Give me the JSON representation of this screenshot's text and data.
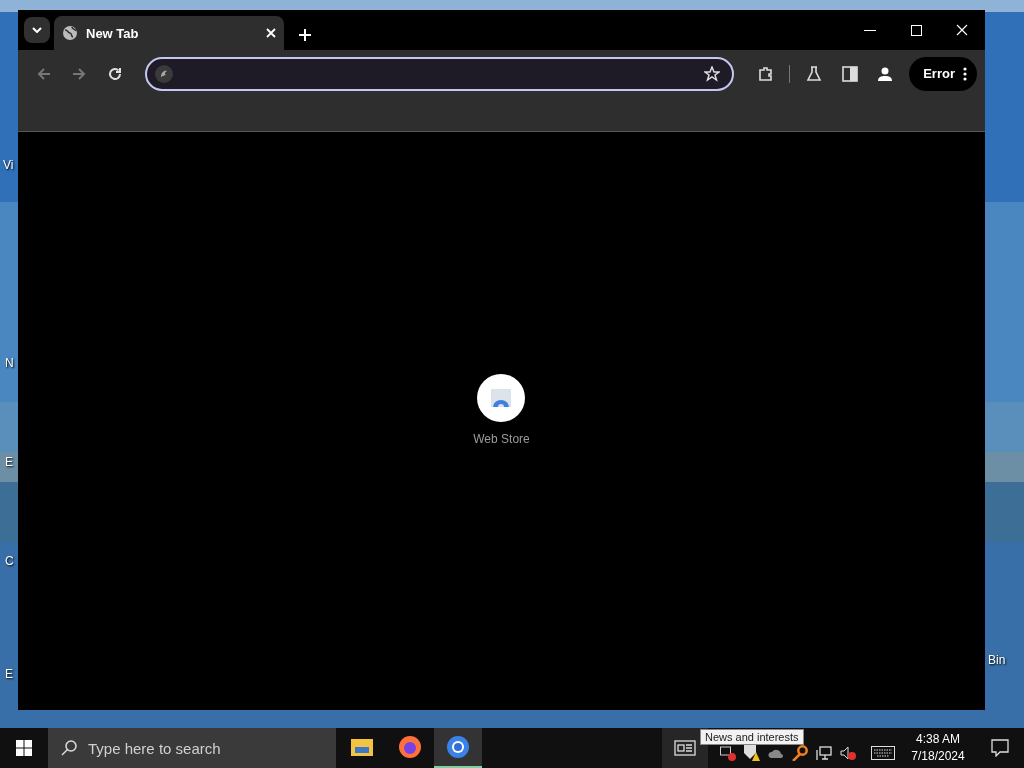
{
  "desktop": {
    "icons": [
      {
        "label": "Vi"
      },
      {
        "label": "N"
      },
      {
        "label": "E"
      },
      {
        "label": "C"
      },
      {
        "label": "E"
      },
      {
        "label": "Bin"
      }
    ]
  },
  "browser": {
    "tabs": [
      {
        "title": "New Tab",
        "selected": true
      }
    ],
    "nav_buttons": [
      {
        "kind": "back",
        "disabled": true
      },
      {
        "kind": "forward",
        "disabled": true
      },
      {
        "kind": "reload",
        "disabled": false
      }
    ],
    "profile_button": {
      "label": "Error"
    },
    "shortcuts": [
      {
        "label": "Web Store"
      }
    ]
  },
  "taskbar": {
    "search": {
      "placeholder": "Type here to search"
    },
    "apps": [
      {
        "kind": "folder",
        "selected": false
      },
      {
        "kind": "firefox",
        "selected": false
      },
      {
        "kind": "chrome",
        "selected": true
      }
    ],
    "tooltip": "News and interests",
    "clock": {
      "time": "4:38 AM",
      "date": "7/18/2024"
    }
  }
}
